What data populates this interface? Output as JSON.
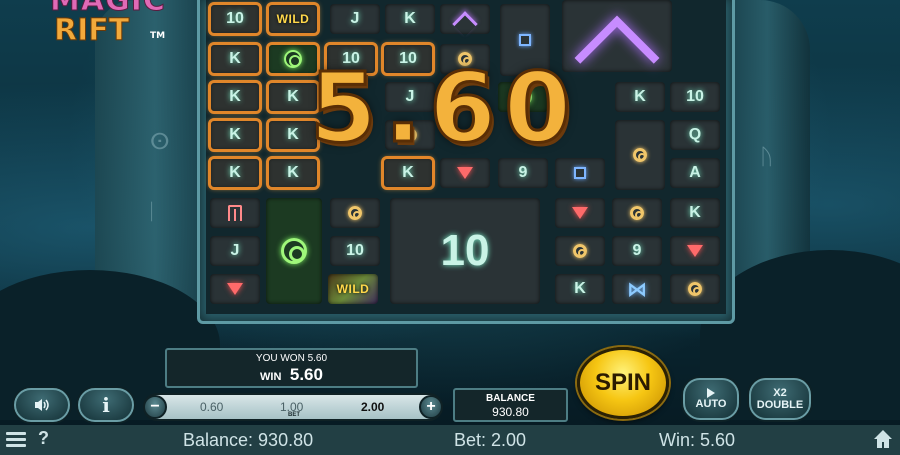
{
  "logo": {
    "line1": "MAGIC",
    "line2": "RIFT",
    "trademark": "TM"
  },
  "colors": {
    "win_frame": "#e0862a",
    "spin_button": "#f6c613",
    "panel_border": "#4d7d84"
  },
  "reels": {
    "r0c0": "10",
    "r0c1": "WILD",
    "r0c2": "J",
    "r0c3": "K",
    "r1c0": "K",
    "r1c2": "10",
    "r1c3": "10",
    "r2c0": "K",
    "r2c1": "K",
    "r2c3": "J",
    "r2c6": "K",
    "r2c7": "10",
    "r3c0": "K",
    "r3c1": "K",
    "r3c7": "Q",
    "r4c0": "K",
    "r4c1": "K",
    "r4c3": "K",
    "r4c5": "9",
    "r4c7": "A",
    "r5c7": "K",
    "r6c0": "J",
    "r6c2": "10",
    "r6c6": "9",
    "r7c2": "WILD",
    "r7c5": "K",
    "big_center": "10"
  },
  "win_amount": "5.60",
  "win_panel": {
    "title": "YOU WON 5.60",
    "win_label": "WIN",
    "win_value": "5.60"
  },
  "bet": {
    "options": [
      "0.60",
      "1.00",
      "2.00"
    ],
    "selected": "2.00",
    "label": "BET",
    "minus": "−",
    "plus": "+"
  },
  "balance_panel": {
    "label": "BALANCE",
    "value": "930.80"
  },
  "spin_label": "SPIN",
  "auto_label": "AUTO",
  "double_label": "DOUBLE",
  "double_prefix": "X2",
  "info_label": "i",
  "status_bar": {
    "balance": "Balance: 930.80",
    "bet": "Bet: 2.00",
    "win": "Win: 5.60",
    "help": "?"
  },
  "icons": [
    "sound-icon",
    "info-icon",
    "menu-icon",
    "help-icon",
    "home-icon",
    "play-icon"
  ]
}
